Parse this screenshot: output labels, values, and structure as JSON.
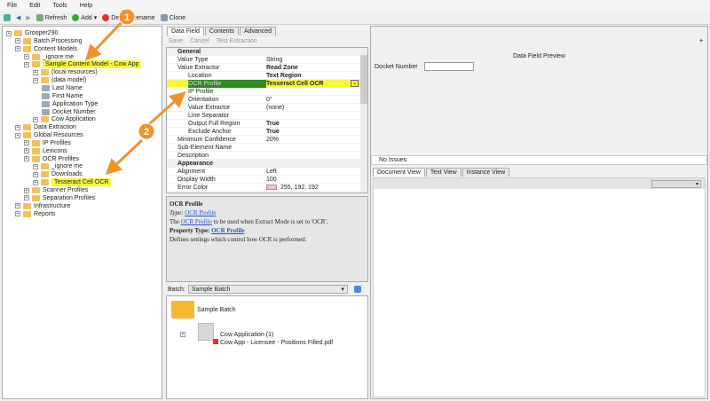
{
  "menu": [
    "File",
    "Edit",
    "Tools",
    "Help"
  ],
  "toolbar": {
    "refresh": "Refresh",
    "add": "Add",
    "delete": "De",
    "rename": "Rename",
    "clone": "Clone"
  },
  "tree": [
    {
      "label": "Grooper290",
      "level": 0
    },
    {
      "label": "Batch Processing",
      "level": 1
    },
    {
      "label": "Content Models",
      "level": 1
    },
    {
      "label": "_ignore me",
      "level": 2
    },
    {
      "label": "Sample Content Model - Cow App",
      "level": 2,
      "highlight": true
    },
    {
      "label": "(local resources)",
      "level": 3
    },
    {
      "label": "(data model)",
      "level": 3
    },
    {
      "label": "Last Name",
      "level": 4
    },
    {
      "label": "First Name",
      "level": 4
    },
    {
      "label": "Application Type",
      "level": 4
    },
    {
      "label": "Docket Number",
      "level": 4
    },
    {
      "label": "Cow Application",
      "level": 3
    },
    {
      "label": "Data Extraction",
      "level": 1
    },
    {
      "label": "Global Resources",
      "level": 1
    },
    {
      "label": "IP Profiles",
      "level": 2
    },
    {
      "label": "Lexicons",
      "level": 2
    },
    {
      "label": "OCR Profiles",
      "level": 2
    },
    {
      "label": "_ignore me",
      "level": 3
    },
    {
      "label": "Downloads",
      "level": 3
    },
    {
      "label": "Tesseract Cell OCR",
      "level": 3,
      "highlight": true
    },
    {
      "label": "Scanner Profiles",
      "level": 2
    },
    {
      "label": "Separation Profiles",
      "level": 2
    },
    {
      "label": "Infrastructure",
      "level": 1
    },
    {
      "label": "Reports",
      "level": 1
    }
  ],
  "tabs": [
    "Data Field",
    "Contents",
    "Advanced"
  ],
  "actions": {
    "save": "Save",
    "cancel": "Cancel",
    "test": "Test Extraction"
  },
  "properties": [
    {
      "k": "General",
      "cat": true
    },
    {
      "k": "Value Type",
      "v": "String",
      "ind": 0
    },
    {
      "k": "Value Extractor",
      "v": "Read Zone",
      "ind": 0,
      "bold": true
    },
    {
      "k": "Location",
      "v": "Text Region",
      "ind": 1,
      "bold": true
    },
    {
      "k": "OCR Profile",
      "v": "Tesseract Cell OCR",
      "ind": 1,
      "bold": true,
      "sel": true
    },
    {
      "k": "IP Profile",
      "v": "",
      "ind": 1
    },
    {
      "k": "Orientation",
      "v": "0°",
      "ind": 1
    },
    {
      "k": "Value Extractor",
      "v": "(none)",
      "ind": 1
    },
    {
      "k": "Line Separator",
      "v": "",
      "ind": 1
    },
    {
      "k": "Output Full Region",
      "v": "True",
      "ind": 1,
      "bold": true
    },
    {
      "k": "Exclude Anchor",
      "v": "True",
      "ind": 1,
      "bold": true
    },
    {
      "k": "Minimum Confidence",
      "v": "20%",
      "ind": 0
    },
    {
      "k": "Sub-Element Name",
      "v": "",
      "ind": 0
    },
    {
      "k": "Description",
      "v": "",
      "ind": 0
    },
    {
      "k": "Appearance",
      "cat": true
    },
    {
      "k": "Alignment",
      "v": "Left",
      "ind": 0
    },
    {
      "k": "Display Width",
      "v": "100",
      "ind": 0
    },
    {
      "k": "Error Color",
      "v": "255, 192, 192",
      "ind": 0,
      "swatch": "#ffc0c0"
    }
  ],
  "help": {
    "title": "OCR Profile",
    "type_label": "Type:",
    "type_link": "OCR Profile",
    "desc_pre": "The",
    "desc_link": "OCR Profile",
    "desc_post": "to be used when Extract Mode is set to 'OCR'.",
    "ptype_label": "Property Type:",
    "ptype_link": "OCR Profile",
    "ptype_desc": "Defines settings which control how OCR is performed."
  },
  "batch": {
    "label": "Batch:",
    "value": "Sample Batch",
    "root": "Sample Batch",
    "folder": "Cow Application (1)",
    "file": "Cow App - Licensee - Positions Filled.pdf"
  },
  "preview": {
    "title": "Data Field Preview",
    "field_label": "Docket Number",
    "field_value": "",
    "issues": "No Issues",
    "view_tabs": [
      "Document View",
      "Text View",
      "Instance View"
    ]
  },
  "callouts": [
    "1",
    "2"
  ],
  "colors": {
    "highlight": "#f6f73a",
    "selected": "#2e8b22",
    "arrow": "#f0922b"
  }
}
